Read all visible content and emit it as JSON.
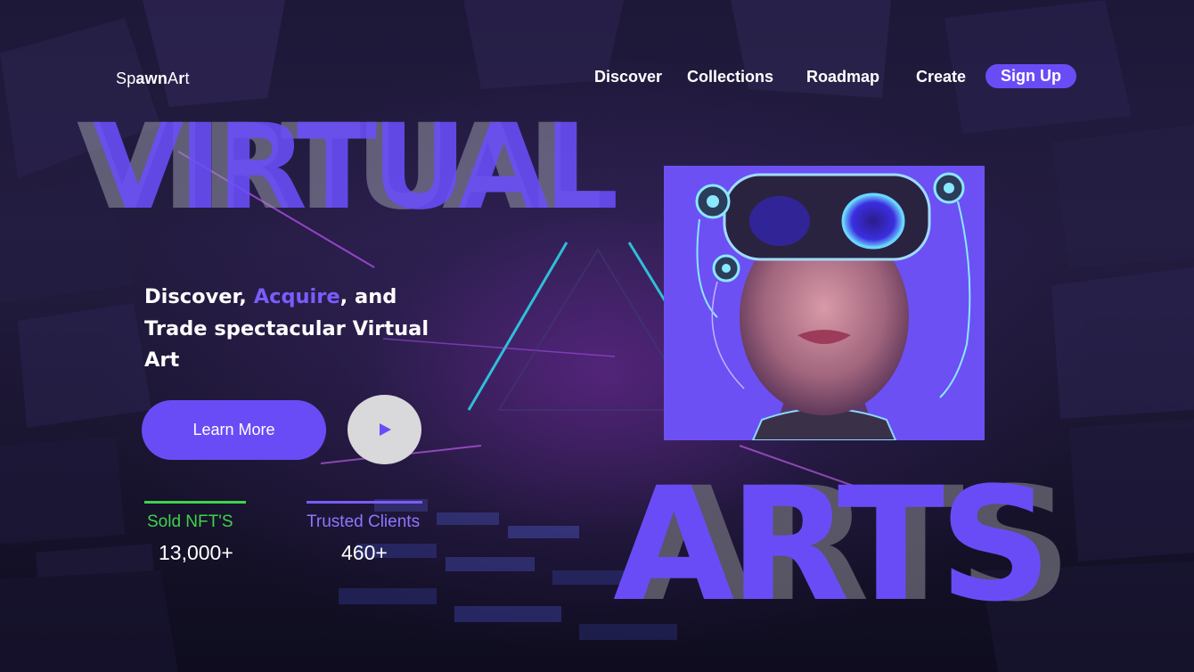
{
  "brand": {
    "logo_prefix": "Sp",
    "logo_mid": "awn",
    "logo_a": "A",
    "logo_r": "r",
    "logo_t": "t"
  },
  "nav": {
    "items": [
      {
        "label": "Discover"
      },
      {
        "label": "Collections"
      },
      {
        "label": "Roadmap"
      },
      {
        "label": "Create"
      }
    ],
    "signup_label": "Sign Up"
  },
  "hero": {
    "word_top": "VIRTUAL",
    "word_bottom": "ARTS",
    "headline_part1": "Discover, ",
    "headline_accent": "Acquire",
    "headline_part2": ", and Trade spectacular Virtual Art",
    "learn_more_label": "Learn More",
    "play_icon": "play-icon"
  },
  "stats": [
    {
      "label": "Sold NFT'S",
      "value": "13,000+",
      "color": "#3fd24a"
    },
    {
      "label": "Trusted Clients",
      "value": "460+",
      "color": "#7a5cff"
    }
  ],
  "colors": {
    "accent": "#6a4cf6",
    "accent_text": "#7a5cff",
    "green": "#3fd24a",
    "play_bg": "#d9d9dc"
  }
}
